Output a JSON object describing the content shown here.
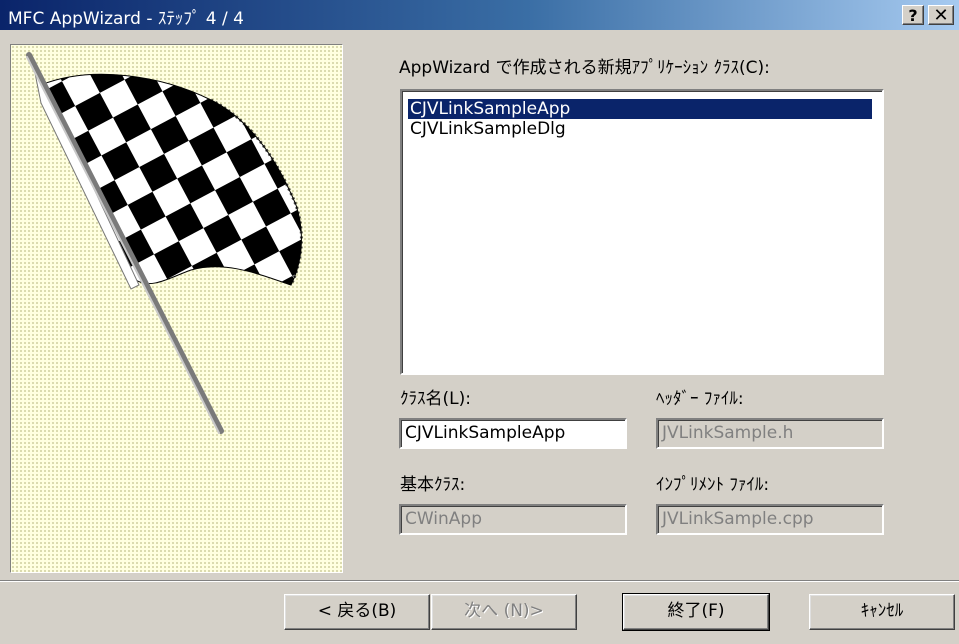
{
  "window": {
    "title": "MFC AppWizard - ｽﾃｯﾌﾟ 4 / 4",
    "help_button": "?",
    "close_button": "✕"
  },
  "classes_label": "AppWizard で作成される新規ｱﾌﾟﾘｹｰｼｮﾝ ｸﾗｽ(C):",
  "classes": [
    {
      "name": "CJVLinkSampleApp",
      "selected": true
    },
    {
      "name": "CJVLinkSampleDlg",
      "selected": false
    }
  ],
  "class_name": {
    "label": "ｸﾗｽ名(L):",
    "value": "CJVLinkSampleApp"
  },
  "header_file": {
    "label": "ﾍｯﾀﾞｰ ﾌｧｲﾙ:",
    "value": "JVLinkSample.h"
  },
  "base_class": {
    "label": "基本ｸﾗｽ:",
    "value": "CWinApp"
  },
  "impl_file": {
    "label": "ｲﾝﾌﾟﾘﾒﾝﾄ ﾌｧｲﾙ:",
    "value": "JVLinkSample.cpp"
  },
  "buttons": {
    "back": "< 戻る(B)",
    "next": "次へ (N)>",
    "finish": "終了(F)",
    "cancel": "ｷｬﾝｾﾙ"
  },
  "colors": {
    "title_active": "#0a246a",
    "selection": "#0a246a",
    "face": "#d4d0c8",
    "panel_bg": "#ffffe0"
  },
  "icons": {
    "wizard_image": "checkered-flag-icon"
  }
}
